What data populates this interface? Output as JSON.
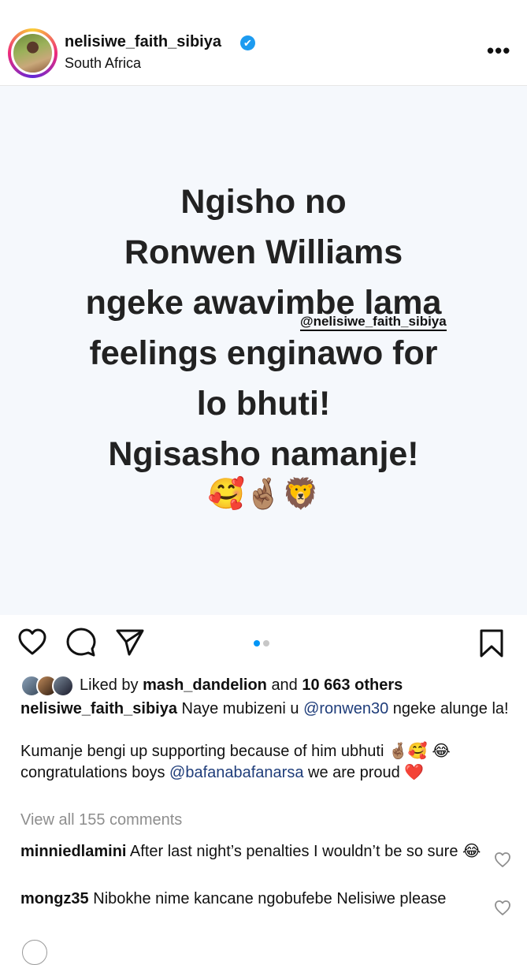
{
  "header": {
    "username": "nelisiwe_faith_sibiya",
    "location": "South Africa",
    "verified_icon": "✔",
    "more_label": "•••"
  },
  "post": {
    "lines": [
      "Ngisho no",
      "Ronwen Williams",
      "ngeke awavimbe lama",
      "feelings enginawo for",
      "lo bhuti!",
      "Ngisasho namanje!"
    ],
    "mention_tag": "@nelisiwe_faith_sibiya",
    "emojis": "🥰🤞🏽🦁",
    "carousel": {
      "count": 2,
      "active": 0
    }
  },
  "actions": {
    "like_icon": "heart-icon",
    "comment_icon": "comment-icon",
    "share_icon": "send-icon",
    "save_icon": "bookmark-icon"
  },
  "likes": {
    "prefix": "Liked by",
    "user": "mash_dandelion",
    "middle": "and",
    "count": "10 663 others"
  },
  "caption": {
    "username": "nelisiwe_faith_sibiya",
    "text1": "Naye mubizeni u",
    "mention1": "@ronwen30",
    "text2": "ngeke alunge la!",
    "text3": "Kumanje bengi up supporting because of him ubhuti 🤞🏽🥰",
    "text4": "😂 congratulations boys",
    "mention2": "@bafanabafanarsa",
    "text5": "we are proud ❤️"
  },
  "view_all": "View all 155 comments",
  "comments": [
    {
      "username": "minniedlamini",
      "text": "After last night’s penalties I wouldn’t be so sure 😂"
    },
    {
      "username": "mongz35",
      "text": "Nibokhe nime kancane ngobufebe Nelisiwe please"
    }
  ],
  "colors": {
    "accent": "#0095f6",
    "link": "#1f3d7a",
    "muted": "#8e8e8e",
    "image_bg": "#f5f8fc"
  }
}
